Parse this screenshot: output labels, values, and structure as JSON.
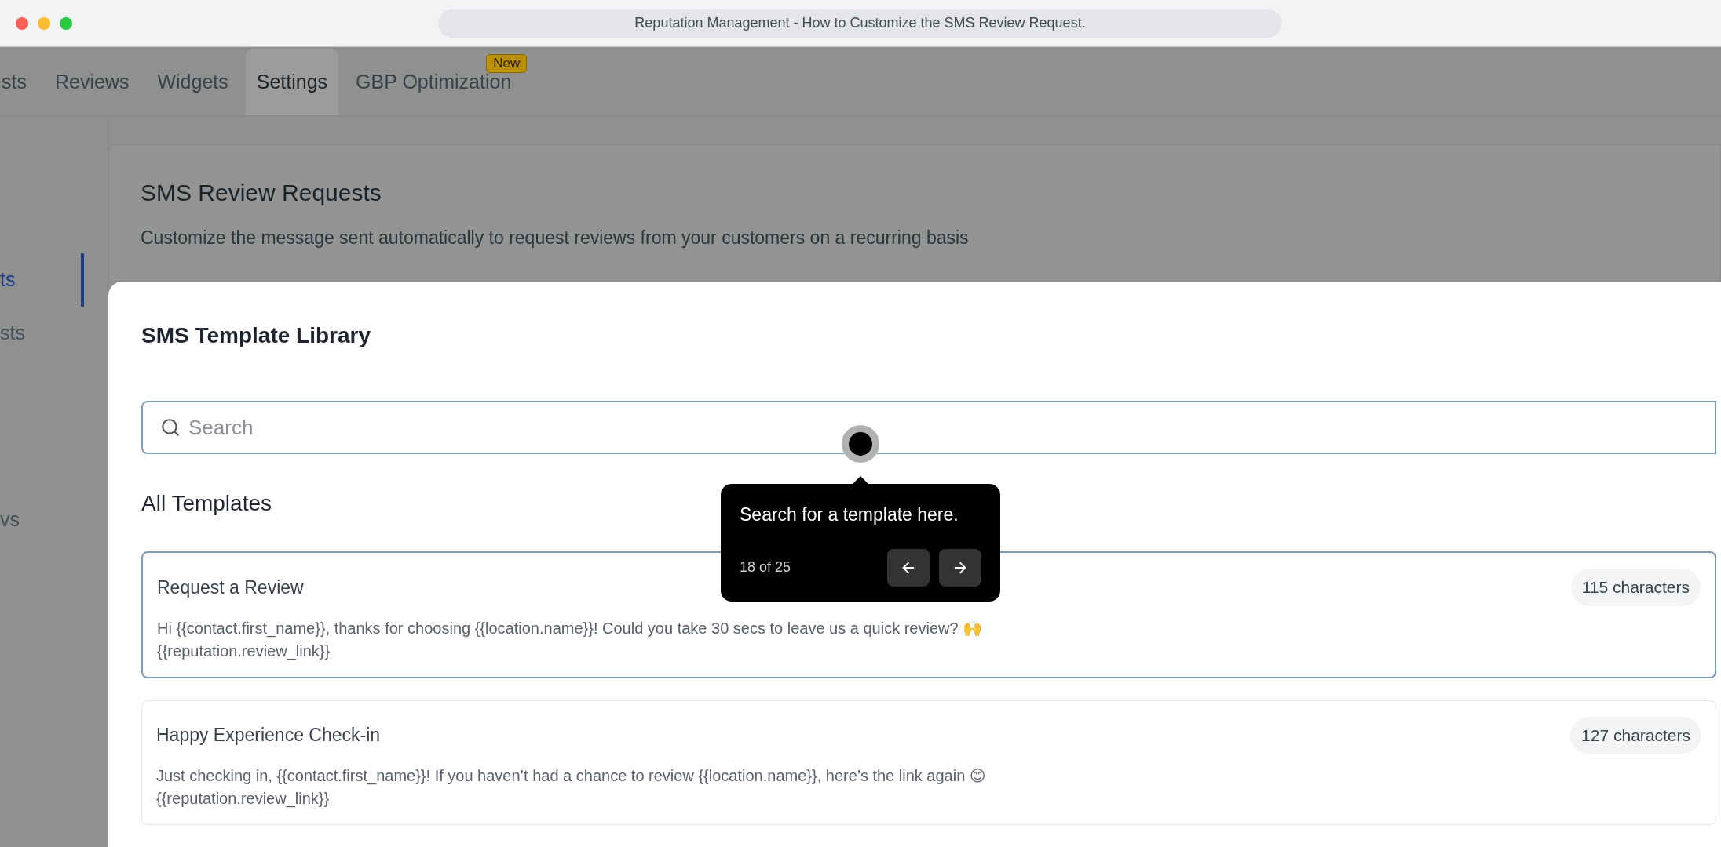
{
  "window": {
    "title": "Reputation Management - How to Customize the SMS Review Request."
  },
  "tabs": [
    {
      "label": "sts",
      "selected": false
    },
    {
      "label": "Reviews",
      "selected": false
    },
    {
      "label": "Widgets",
      "selected": false
    },
    {
      "label": "Settings",
      "selected": true
    },
    {
      "label": "GBP Optimization",
      "selected": false,
      "badge": "New"
    }
  ],
  "sidebar": {
    "items": [
      {
        "label": "ts",
        "selected": true
      },
      {
        "label": "sts",
        "selected": false
      },
      {
        "label": "vs",
        "selected": false
      }
    ]
  },
  "section": {
    "title": "SMS Review Requests",
    "subtitle": "Customize the message sent automatically to request reviews from your customers on a recurring basis"
  },
  "modal": {
    "title": "SMS Template Library",
    "search": {
      "placeholder": "Search",
      "focused": true
    },
    "list_title": "All Templates",
    "templates": [
      {
        "name": "Request a Review",
        "count": "115 characters",
        "body": "Hi {{contact.first_name}}, thanks for choosing {{location.name}}! Could you take 30 secs to leave us a quick review? 🙌",
        "link": "{{reputation.review_link}}",
        "selected": true
      },
      {
        "name": "Happy Experience Check-in",
        "count": "127 characters",
        "body": "Just checking in, {{contact.first_name}}! If you haven’t had a chance to review {{location.name}}, here’s the link again 😊",
        "link": "{{reputation.review_link}}",
        "selected": false
      }
    ]
  },
  "tour": {
    "text": "Search for a template here.",
    "step": "18 of 25"
  }
}
